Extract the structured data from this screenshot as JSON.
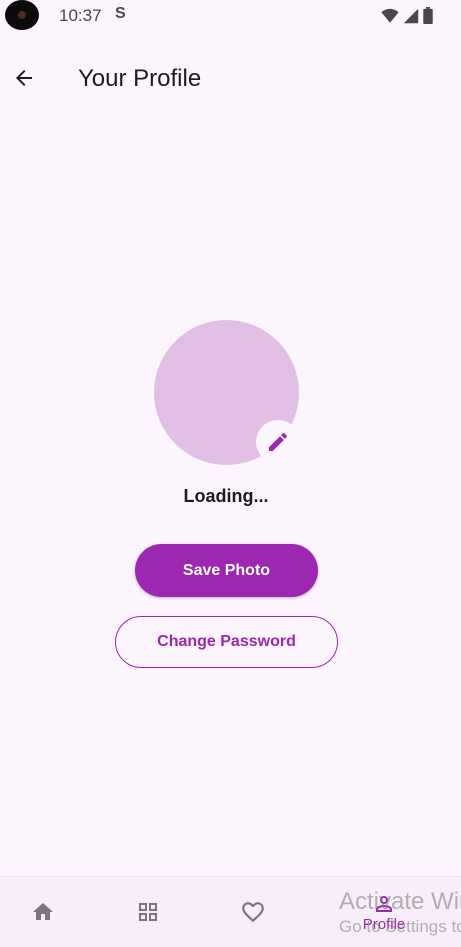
{
  "status_bar": {
    "time": "10:37",
    "sim_indicator": "S",
    "icons": [
      "wifi-icon",
      "signal-icon",
      "battery-icon"
    ]
  },
  "app_bar": {
    "title": "Your Profile",
    "back_icon": "arrow-back-icon"
  },
  "profile": {
    "status_text": "Loading...",
    "edit_icon": "pencil-icon"
  },
  "actions": {
    "save_photo_label": "Save Photo",
    "change_password_label": "Change Password"
  },
  "bottom_nav": {
    "items": [
      {
        "icon": "home-icon",
        "label": ""
      },
      {
        "icon": "grid-icon",
        "label": ""
      },
      {
        "icon": "heart-icon",
        "label": ""
      },
      {
        "icon": "person-icon",
        "label": "Profile"
      }
    ],
    "active": "Profile"
  },
  "watermark": {
    "title": "Activate Windows",
    "subtitle": "Go to Settings to activate Windows."
  },
  "colors": {
    "background": "#fdf5fd",
    "primary": "#9c27b0",
    "avatar": "#e1bfe5",
    "nav_background": "#f8eef9",
    "inactive_icon": "#7a757d"
  }
}
